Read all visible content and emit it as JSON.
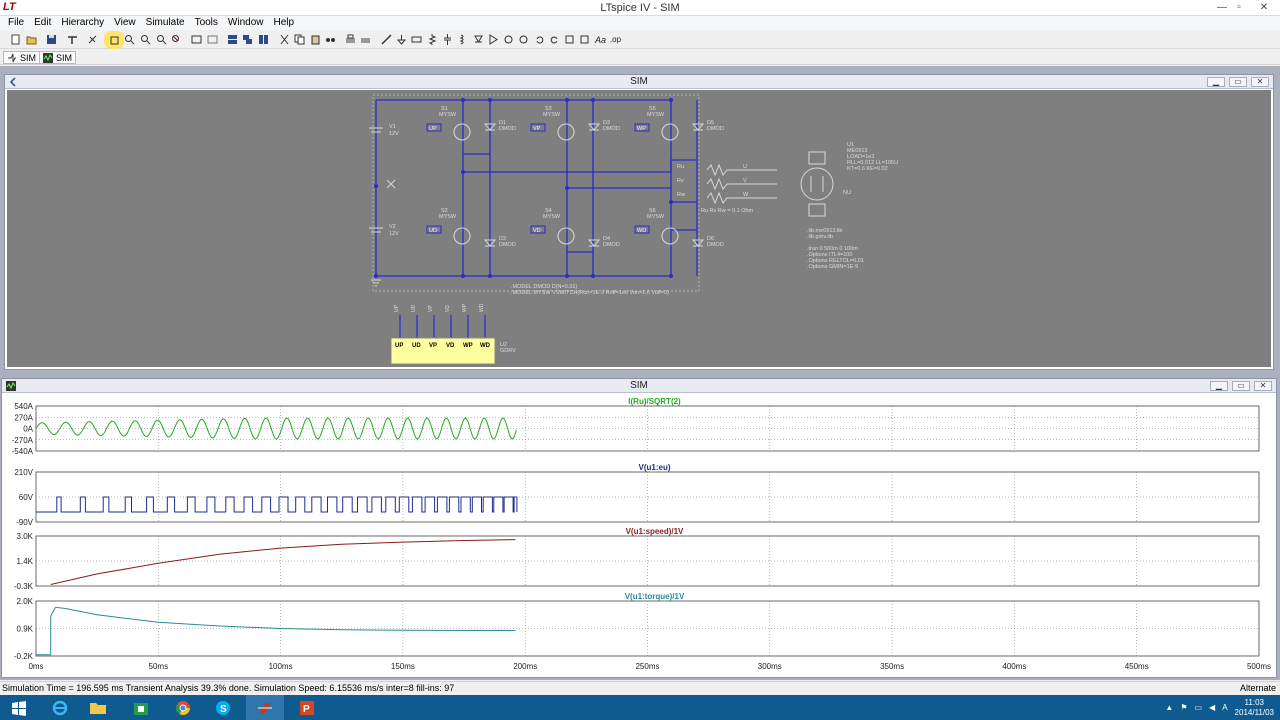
{
  "window": {
    "title": "LTspice IV - SIM",
    "app_icon": "ltspice-logo-icon",
    "controls": [
      "—",
      "▫",
      "✕"
    ]
  },
  "menu": [
    "File",
    "Edit",
    "Hierarchy",
    "View",
    "Simulate",
    "Tools",
    "Window",
    "Help"
  ],
  "tabs": [
    {
      "label": "SIM",
      "icon": "schematic-icon"
    },
    {
      "label": "SIM",
      "icon": "waveform-icon"
    }
  ],
  "schematic_window": {
    "title": "SIM",
    "labels": {
      "v1": "V1",
      "v1_val": "12V",
      "v2": "V2",
      "v2_val": "12V",
      "s1": "S1",
      "s1_model": "MYSW",
      "s2": "S2",
      "s2_model": "MYSW",
      "s3": "S3",
      "s3_model": "MYSW",
      "s4": "S4",
      "s4_model": "MYSW",
      "s5": "S5",
      "s5_model": "MYSW",
      "s6": "S6",
      "s6_model": "MYSW",
      "d1": "D1",
      "d2": "D2",
      "d3": "D3",
      "d4": "D4",
      "d5": "D5",
      "d6": "D6",
      "diode_model": "DMOD",
      "up": "UP",
      "ud": "UD",
      "vp": "VP",
      "vd": "VD",
      "wp": "WP",
      "wd": "WD",
      "ru": "Ru",
      "rv": "Rv",
      "rw": "Rw",
      "res_val": "Ru Rv Rw = 0.1 Ohm",
      "u": "U",
      "v": "V",
      "w": "W",
      "nu": "NU",
      "u1": "U1",
      "u1_model": "ME0913",
      "u1_load": "LOAD=1e3",
      "u1_params1": "RLL=0.012 LL=105U",
      "u1_params2": "KT=0.6 KE=0.02",
      "lib1": ".lib me0913.lib",
      "lib2": ".lib gdrv.lib",
      "tran": ".tran 0 500m 0 100m",
      "opt1": ".Options ITL4=100",
      "opt2": ".Options RELTOL=0.01",
      "opt3": ".Options GMIN=1E-9",
      "model1": ".MODEL DMOD D(N=0.01)",
      "model2": ".MODEL MYSW VSWITCH(Ron=1E-3 Roff=1e6 Von=1.6 Voff=0)",
      "u2": "U2",
      "u2_model": "GDRV"
    },
    "gdrv_pins": [
      "UP",
      "UD",
      "VP",
      "VD",
      "WP",
      "WD"
    ]
  },
  "plot_window": {
    "title": "SIM",
    "x_ticks": [
      "0ms",
      "50ms",
      "100ms",
      "150ms",
      "200ms",
      "250ms",
      "300ms",
      "350ms",
      "400ms",
      "450ms",
      "500ms"
    ]
  },
  "chart_data": [
    {
      "type": "line",
      "title": "I(Ru)/SQRT(2)",
      "color": "#22aa22",
      "ylabel_ticks": [
        "540A",
        "270A",
        "0A",
        "-270A",
        "-540A"
      ],
      "ylim": [
        -540,
        540
      ],
      "x_range_ms": [
        0,
        500
      ],
      "series": [
        {
          "name": "I(Ru)/SQRT(2)",
          "x_ms": [
            0,
            196.6
          ],
          "note_type": "ac_oscillation",
          "amplitude": 250,
          "cycles": 20
        }
      ]
    },
    {
      "type": "line",
      "title": "V(u1:eu)",
      "color": "#1c2d8a",
      "ylabel_ticks": [
        "210V",
        "60V",
        "-90V"
      ],
      "ylim": [
        -90,
        210
      ],
      "x_range_ms": [
        0,
        500
      ],
      "series": [
        {
          "name": "V(u1:eu)",
          "x_ms": [
            0,
            196.6
          ],
          "note_type": "pwm",
          "high": 60,
          "low": -30
        }
      ]
    },
    {
      "type": "line",
      "title": "V(u1:speed)/1V",
      "color": "#8b1a1a",
      "ylabel_ticks": [
        "3.0K",
        "1.4K",
        "-0.3K"
      ],
      "ylim": [
        -300,
        3000
      ],
      "x_range_ms": [
        0,
        500
      ],
      "series": [
        {
          "name": "V(u1:speed)/1V",
          "x": [
            6,
            25,
            50,
            75,
            100,
            125,
            150,
            175,
            196
          ],
          "y": [
            -200,
            500,
            1200,
            1800,
            2200,
            2450,
            2600,
            2700,
            2760
          ]
        }
      ]
    },
    {
      "type": "line",
      "title": "V(u1:torque)/1V",
      "color": "#2a8a96",
      "ylabel_ticks": [
        "2.0K",
        "0.9K",
        "-0.2K"
      ],
      "ylim": [
        -200,
        2000
      ],
      "x_range_ms": [
        0,
        500
      ],
      "series": [
        {
          "name": "V(u1:torque)/1V",
          "x": [
            0,
            6,
            6,
            8,
            12,
            25,
            50,
            75,
            100,
            125,
            150,
            175,
            196
          ],
          "y": [
            -150,
            -150,
            1400,
            1750,
            1700,
            1450,
            1150,
            1000,
            900,
            850,
            830,
            820,
            820
          ]
        }
      ]
    }
  ],
  "status": {
    "text": "Simulation Time = 196.595 ms  Transient Analysis 39.3% done. Simulation Speed: 6.15536 ms/s inter=8 fill-ins: 97",
    "right": "Alternate"
  },
  "taskbar": {
    "time": "11:03",
    "date": "2014/11/03",
    "apps": [
      "windows-start-icon",
      "internet-explorer-icon",
      "file-explorer-icon",
      "store-icon",
      "chrome-icon",
      "skype-icon",
      "ltspice-icon",
      "powerpoint-icon"
    ]
  }
}
